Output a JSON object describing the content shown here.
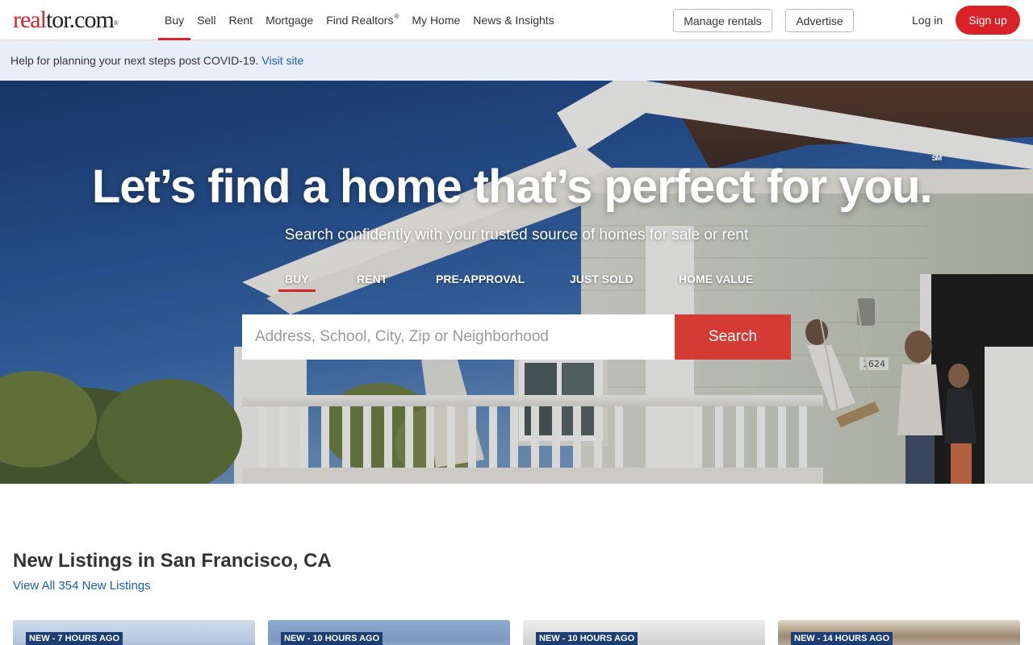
{
  "header": {
    "logo_red": "real",
    "logo_rest": "tor.com",
    "logo_mark": "®",
    "nav": [
      {
        "label": "Buy"
      },
      {
        "label": "Sell"
      },
      {
        "label": "Rent"
      },
      {
        "label": "Mortgage"
      },
      {
        "label": "Find Realtors",
        "mark": "®"
      },
      {
        "label": "My Home"
      },
      {
        "label": "News & Insights"
      }
    ],
    "active_nav": "Buy",
    "manage_rentals": "Manage rentals",
    "advertise": "Advertise",
    "login": "Log in",
    "signup": "Sign up"
  },
  "banner": {
    "text": "Help for planning your next steps post COVID-19.",
    "link": "Visit site"
  },
  "hero": {
    "title": "Let’s find a home that’s perfect for you.",
    "title_mark": "SM",
    "subtitle": "Search confidently with your trusted source of homes for sale or rent",
    "tabs": [
      {
        "label": "BUY"
      },
      {
        "label": "RENT"
      },
      {
        "label": "PRE-APPROVAL"
      },
      {
        "label": "JUST SOLD"
      },
      {
        "label": "HOME VALUE"
      }
    ],
    "active_tab": "BUY",
    "search_placeholder": "Address, School, City, Zip or Neighborhood",
    "search_button": "Search",
    "house_number": "1624"
  },
  "listings": {
    "title": "New Listings in San Francisco, CA",
    "view_all": "View All 354 New Listings",
    "cards": [
      {
        "badge": "NEW - 7 HOURS AGO"
      },
      {
        "badge": "NEW - 10 HOURS AGO"
      },
      {
        "badge": "NEW - 10 HOURS AGO"
      },
      {
        "badge": "NEW - 14 HOURS AGO"
      }
    ]
  },
  "colors": {
    "brand_red": "#d92228",
    "search_red": "#d33b34",
    "link_blue": "#1a5ea8",
    "badge_navy": "#1d3e72",
    "banner_bg": "#e8eef8"
  }
}
